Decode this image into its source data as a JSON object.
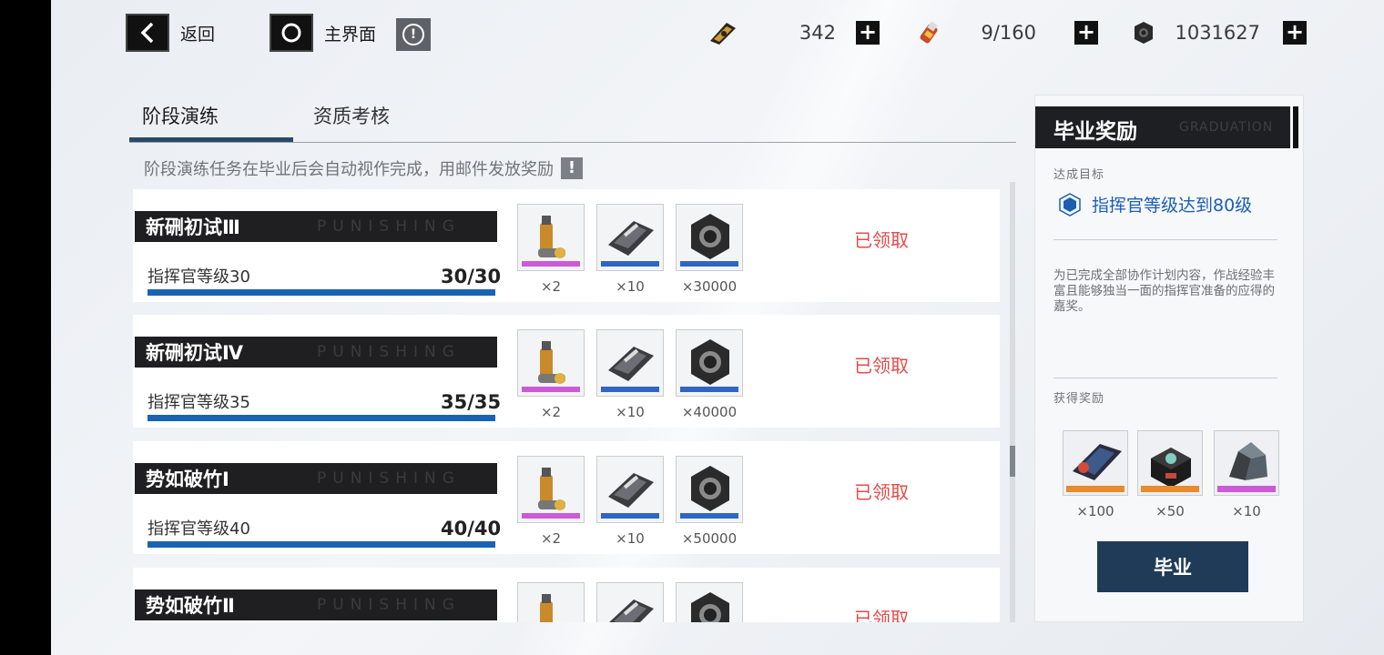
{
  "header": {
    "back_label": "返回",
    "home_label": "主界面",
    "resources": [
      {
        "icon": "blackcard-ticket-icon",
        "value": "342"
      },
      {
        "icon": "serum-battery-icon",
        "value": "9/160"
      },
      {
        "icon": "cog-coin-icon",
        "value": "1031627"
      }
    ]
  },
  "tabs": [
    {
      "label": "阶段演练",
      "active": true
    },
    {
      "label": "资质考核",
      "active": false
    }
  ],
  "notice": "阶段演练任务在毕业后会自动视作完成，用邮件发放奖励",
  "watermark": "PUNISHING",
  "tasks": [
    {
      "title": "新硎初试Ⅲ",
      "condition": "指挥官等级30",
      "progress": "30/30",
      "progress_fraction": 1.0,
      "rewards": [
        {
          "icon": "exp-canister-icon",
          "count": "×2"
        },
        {
          "icon": "chip-module-icon",
          "count": "×10"
        },
        {
          "icon": "hex-nut-icon",
          "count": "×30000"
        }
      ],
      "status": "已领取"
    },
    {
      "title": "新硎初试Ⅳ",
      "condition": "指挥官等级35",
      "progress": "35/35",
      "progress_fraction": 1.0,
      "rewards": [
        {
          "icon": "exp-canister-icon",
          "count": "×2"
        },
        {
          "icon": "chip-module-icon",
          "count": "×10"
        },
        {
          "icon": "hex-nut-icon",
          "count": "×40000"
        }
      ],
      "status": "已领取"
    },
    {
      "title": "势如破竹Ⅰ",
      "condition": "指挥官等级40",
      "progress": "40/40",
      "progress_fraction": 1.0,
      "rewards": [
        {
          "icon": "exp-canister-icon",
          "count": "×2"
        },
        {
          "icon": "chip-module-icon",
          "count": "×10"
        },
        {
          "icon": "hex-nut-icon",
          "count": "×50000"
        }
      ],
      "status": "已领取"
    },
    {
      "title": "势如破竹Ⅱ",
      "condition": "",
      "progress": "",
      "progress_fraction": 1.0,
      "rewards": [
        {
          "icon": "exp-canister-icon",
          "count": ""
        },
        {
          "icon": "chip-module-icon",
          "count": ""
        },
        {
          "icon": "hex-nut-icon",
          "count": ""
        }
      ],
      "status": "已领取"
    }
  ],
  "panel": {
    "title": "毕业奖励",
    "title_watermark": "GRADUATION",
    "goal_label": "达成目标",
    "goal": "指挥官等级达到80级",
    "description": "为已完成全部协作计划内容，作战经验丰富且能够独当一面的指挥官准备的应得的嘉奖。",
    "reward_label": "获得奖励",
    "rewards": [
      {
        "icon": "supply-card-icon",
        "count": "×100"
      },
      {
        "icon": "supply-chest-icon",
        "count": "×50"
      },
      {
        "icon": "ore-crystal-icon",
        "count": "×10"
      }
    ],
    "button": "毕业"
  },
  "colors": {
    "accent_blue": "#1a63b3",
    "claimed_red": "#e54a4a",
    "button_navy": "#1f3b58",
    "dark_bar": "#1f1f21"
  }
}
